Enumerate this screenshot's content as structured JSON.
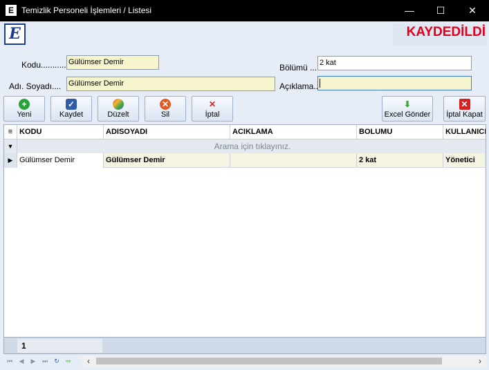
{
  "window": {
    "title": "Temizlik Personeli İşlemleri  / Listesi",
    "app_icon_letter": "E",
    "minimize_glyph": "—",
    "maximize_glyph": "☐",
    "close_glyph": "✕"
  },
  "logo": {
    "letter": "E"
  },
  "status": {
    "text": "KAYDEDİLDİ",
    "color": "#e0001b"
  },
  "form": {
    "kodu_label": "Kodu...........",
    "kodu_value": "Gülümser Demir",
    "adsoyad_label": "Adı. Soyadı....",
    "adsoyad_value": "Gülümser Demir",
    "bolumu_label": "Bölümü ...",
    "bolumu_value": "2 kat",
    "aciklama_label": "Açıklama..",
    "aciklama_value": ""
  },
  "toolbar": {
    "new_label": "Yeni",
    "save_label": "Kaydet",
    "edit_label": "Düzelt",
    "delete_label": "Sil",
    "cancel_label": "İptal",
    "excel_label": "Excel Gönder",
    "close_label": "İptal Kapat",
    "new_glyph": "+",
    "save_glyph": "✓",
    "delete_glyph": "✕",
    "cancel_glyph": "✕",
    "excel_glyph": "⬇",
    "close_glyph": "✕"
  },
  "grid": {
    "menu_glyph": "≡",
    "columns": [
      "KODU",
      "ADISOYADI",
      "ACIKLAMA",
      "BOLUMU",
      "KULLANICI"
    ],
    "filter_glyph": "▼",
    "filter_hint": "Arama için tıklayınız.",
    "row_indicator": "▶",
    "rows": [
      {
        "kodu": "Gülümser Demir",
        "adisoyadi": "Gülümser Demir",
        "aciklama": "",
        "bolumu": "2 kat",
        "kullanici": "Yönetici"
      }
    ],
    "footer_count": "1"
  },
  "navigator": {
    "first": "⏮",
    "prev": "◀",
    "next": "▶",
    "last": "⏭",
    "refresh": "↻",
    "export": "⇨",
    "scroll_left": "‹",
    "scroll_right": "›"
  },
  "icons": [
    "app-e-icon",
    "plus-circle-icon",
    "checkbox-icon",
    "beach-ball-icon",
    "delete-circle-icon",
    "red-x-icon",
    "excel-export-icon",
    "close-red-icon",
    "grid-menu-icon",
    "filter-icon",
    "row-arrow-icon"
  ],
  "colors": {
    "titlebar": "#000000",
    "client_bg": "#e6edf7",
    "input_yellow": "#f7f5cd",
    "accent_red": "#e0001b"
  }
}
